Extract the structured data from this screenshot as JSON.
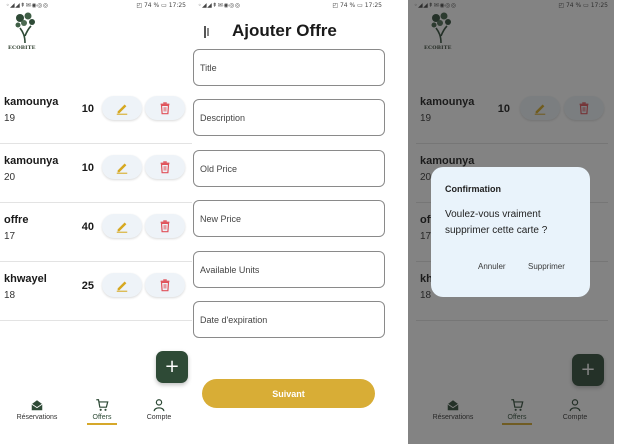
{
  "status": {
    "left_icons": "◦◢◢⇞✉◉◎◎",
    "right_text": "◰ 74 % ▭ 17:25"
  },
  "brand": {
    "name": "ECOBITE"
  },
  "offers": [
    {
      "name": "kamounya",
      "number": "19",
      "qty": "10"
    },
    {
      "name": "kamounya",
      "number": "20",
      "qty": "10"
    },
    {
      "name": "offre",
      "number": "17",
      "qty": "40"
    },
    {
      "name": "khwayel",
      "number": "18",
      "qty": "25"
    }
  ],
  "nav": {
    "reservations": "Réservations",
    "offers": "Offers",
    "account": "Compte"
  },
  "form": {
    "title": "Ajouter Offre",
    "fields": {
      "title": "Title",
      "description": "Description",
      "old_price": "Old Price",
      "new_price": "New Price",
      "available_units": "Available Units",
      "expiration": "Date d'expiration"
    },
    "submit": "Suivant"
  },
  "dialog": {
    "title": "Confirmation",
    "message": "Voulez-vous vraiment supprimer cette carte ?",
    "cancel": "Annuler",
    "confirm": "Supprimer"
  },
  "colors": {
    "primary_green": "#2e4a36",
    "accent_gold": "#d8ad36",
    "delete_red": "#e0525a",
    "edit_gold": "#d6a820"
  }
}
